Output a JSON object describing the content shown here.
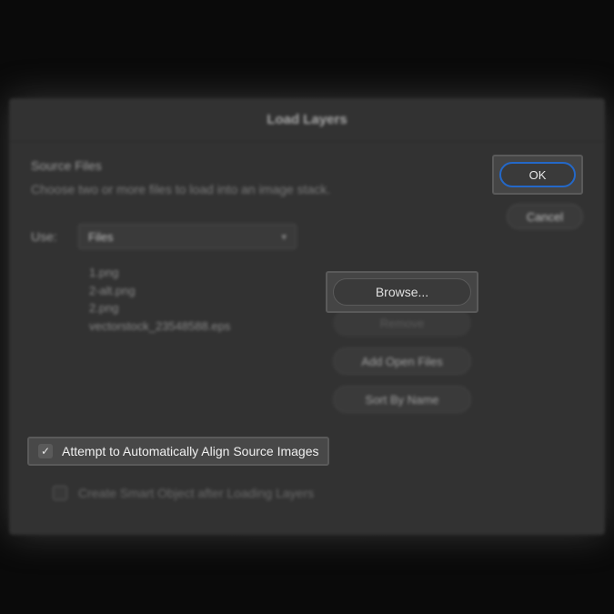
{
  "dialog": {
    "title": "Load Layers",
    "section_title": "Source Files",
    "section_desc": "Choose two or more files to load into an image stack.",
    "use_label": "Use:",
    "use_value": "Files",
    "files": [
      "1.png",
      "2-alt.png",
      "2.png",
      "vectorstock_23548588.eps"
    ],
    "buttons": {
      "ok": "OK",
      "cancel": "Cancel",
      "browse": "Browse...",
      "remove": "Remove",
      "add_open": "Add Open Files",
      "sort": "Sort By Name"
    },
    "checkboxes": {
      "align": "Attempt to Automatically Align Source Images",
      "smart": "Create Smart Object after Loading Layers"
    }
  }
}
